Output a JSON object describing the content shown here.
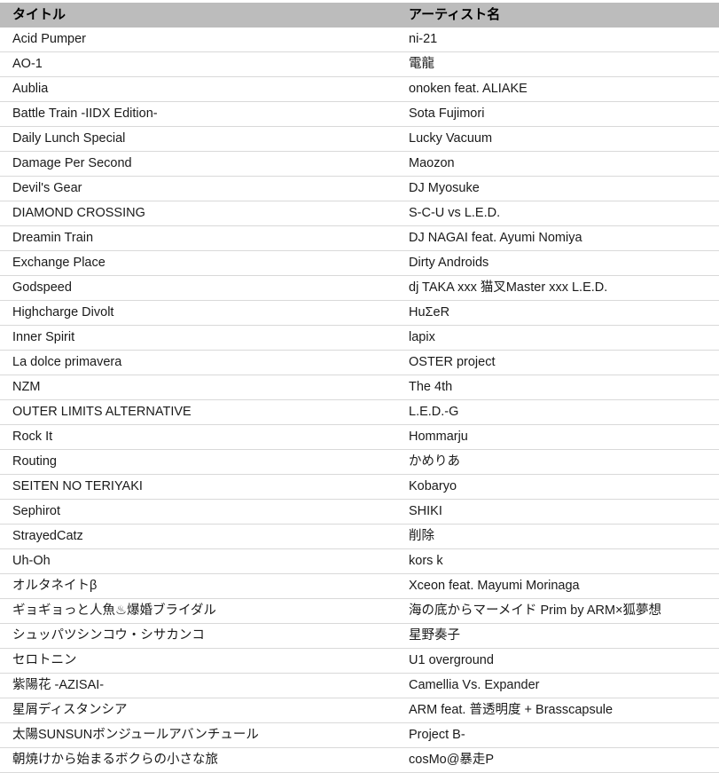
{
  "table": {
    "columns": [
      {
        "key": "title",
        "label": "タイトル"
      },
      {
        "key": "artist",
        "label": "アーティスト名"
      }
    ],
    "header_bg": "#bcbcbc",
    "row_divider": "#d9d9d9",
    "text_color": "#1a1a1a",
    "rows": [
      {
        "title": "Acid Pumper",
        "artist": "ni-21"
      },
      {
        "title": "AO-1",
        "artist": "電龍"
      },
      {
        "title": "Aublia",
        "artist": "onoken feat. ALIAKE"
      },
      {
        "title": "Battle Train -IIDX Edition-",
        "artist": "Sota Fujimori"
      },
      {
        "title": "Daily Lunch Special",
        "artist": "Lucky Vacuum"
      },
      {
        "title": "Damage Per Second",
        "artist": "Maozon"
      },
      {
        "title": "Devil's Gear",
        "artist": "DJ Myosuke"
      },
      {
        "title": "DIAMOND CROSSING",
        "artist": "S-C-U vs L.E.D."
      },
      {
        "title": "Dreamin Train",
        "artist": "DJ NAGAI feat. Ayumi Nomiya"
      },
      {
        "title": "Exchange Place",
        "artist": "Dirty Androids"
      },
      {
        "title": "Godspeed",
        "artist": "dj TAKA xxx 猫叉Master xxx L.E.D."
      },
      {
        "title": "Highcharge Divolt",
        "artist": "HuΣeR"
      },
      {
        "title": "Inner Spirit",
        "artist": "lapix"
      },
      {
        "title": "La dolce primavera",
        "artist": "OSTER project"
      },
      {
        "title": "NZM",
        "artist": "The 4th"
      },
      {
        "title": "OUTER LIMITS ALTERNATIVE",
        "artist": "L.E.D.-G"
      },
      {
        "title": "Rock It",
        "artist": "Hommarju"
      },
      {
        "title": "Routing",
        "artist": "かめりあ"
      },
      {
        "title": "SEITEN NO TERIYAKI",
        "artist": "Kobaryo"
      },
      {
        "title": "Sephirot",
        "artist": "SHIKI"
      },
      {
        "title": "StrayedCatz",
        "artist": "削除"
      },
      {
        "title": "Uh-Oh",
        "artist": "kors k"
      },
      {
        "title": "オルタネイトβ",
        "artist": "Xceon feat. Mayumi Morinaga"
      },
      {
        "title": "ギョギョっと人魚♨爆婚ブライダル",
        "artist": "海の底からマーメイド Prim by ARM×狐夢想"
      },
      {
        "title": "シュッパツシンコウ・シサカンコ",
        "artist": "星野奏子"
      },
      {
        "title": "セロトニン",
        "artist": "U1 overground"
      },
      {
        "title": "紫陽花 -AZISAI-",
        "artist": "Camellia Vs. Expander"
      },
      {
        "title": "星屑ディスタンシア",
        "artist": "ARM feat. 普透明度 + Brasscapsule"
      },
      {
        "title": "太陽SUNSUNボンジュールアバンチュール",
        "artist": "Project B-"
      },
      {
        "title": "朝焼けから始まるボクらの小さな旅",
        "artist": "cosMo@暴走P"
      }
    ]
  }
}
